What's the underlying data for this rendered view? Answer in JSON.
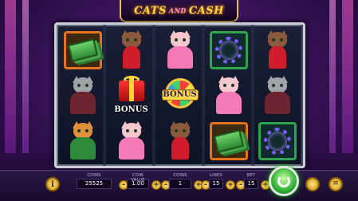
{
  "logo": {
    "part1": "CATS",
    "and": "AND",
    "part2": "CASH"
  },
  "reels": [
    [
      "money",
      "cat-brown",
      "cat-pink",
      "necklace",
      "cat-brown"
    ],
    [
      "cat-grey",
      "bonus-gift",
      "bonus-wheel",
      "cat-pink",
      "cat-grey"
    ],
    [
      "cat-orange",
      "cat-pink",
      "cat-brown",
      "money",
      "necklace"
    ]
  ],
  "bonus_labels": {
    "gift": "BONUS",
    "wheel": "BONUS"
  },
  "bar": {
    "coins": {
      "label": "COINS",
      "value": "25525"
    },
    "coin_value": {
      "label": "COIN VALUE",
      "value": "1.00"
    },
    "coins_bet": {
      "label": "COINS",
      "value": "1"
    },
    "lines": {
      "label": "LINES",
      "value": "15"
    },
    "bet": {
      "label": "BET",
      "value": "15"
    },
    "minus": "-",
    "plus": "+",
    "info": "i",
    "menu": "≡"
  }
}
